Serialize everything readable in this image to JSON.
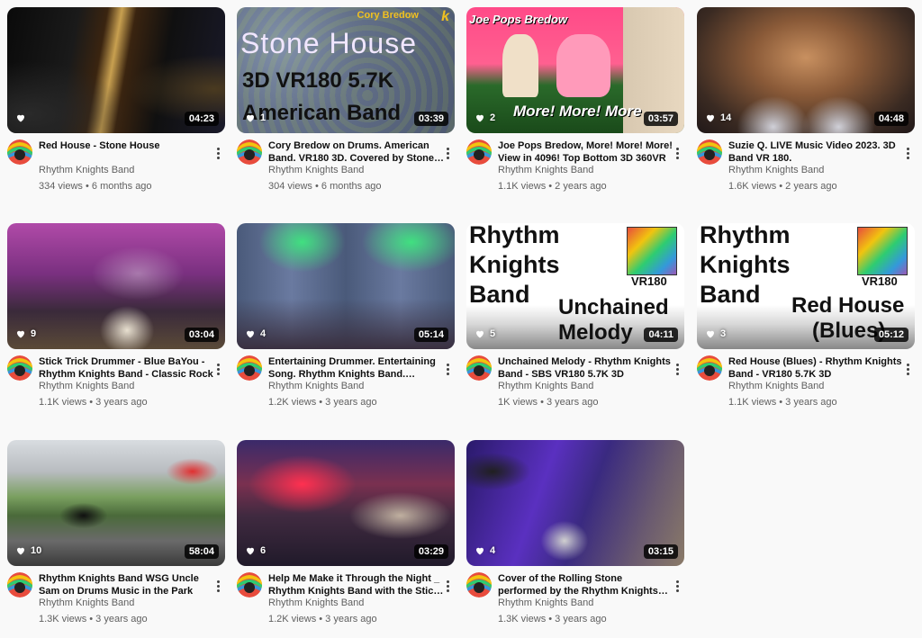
{
  "channel_name": "Rhythm Knights Band",
  "videos": [
    {
      "title": "Red House - Stone House",
      "views": "334 views",
      "age": "6 months ago",
      "likes": "",
      "duration": "04:23"
    },
    {
      "title": "Cory Bredow on Drums. American Band. VR180 3D. Covered by Stone House",
      "views": "304 views",
      "age": "6 months ago",
      "likes": "1",
      "duration": "03:39"
    },
    {
      "title": "Joe Pops Bredow, More! More! More! View in 4096! Top Bottom 3D 360VR",
      "views": "1.1K views",
      "age": "2 years ago",
      "likes": "2",
      "duration": "03:57"
    },
    {
      "title": "Suzie Q. LIVE Music Video 2023. 3D Band VR 180.",
      "views": "1.6K views",
      "age": "2 years ago",
      "likes": "14",
      "duration": "04:48"
    },
    {
      "title": "Stick Trick Drummer - Blue BaYou - Rhythm Knights Band - Classic Rock",
      "views": "1.1K views",
      "age": "3 years ago",
      "likes": "9",
      "duration": "03:04"
    },
    {
      "title": "Entertaining Drummer. Entertaining Song. Rhythm Knights Band. Stealing",
      "views": "1.2K views",
      "age": "3 years ago",
      "likes": "4",
      "duration": "05:14"
    },
    {
      "title": "Unchained Melody - Rhythm Knights Band - SBS VR180 5.7K 3D",
      "views": "1K views",
      "age": "3 years ago",
      "likes": "5",
      "duration": "04:11"
    },
    {
      "title": "Red House (Blues) - Rhythm Knights Band - VR180 5.7K 3D",
      "views": "1.1K views",
      "age": "3 years ago",
      "likes": "3",
      "duration": "05:12"
    },
    {
      "title": "Rhythm Knights Band WSG Uncle Sam on Drums Music in the Park",
      "views": "1.3K views",
      "age": "3 years ago",
      "likes": "10",
      "duration": "58:04"
    },
    {
      "title": "Help Me Make it Through the Night _ Rhythm Knights Band with the Stick Trick",
      "views": "1.2K views",
      "age": "3 years ago",
      "likes": "6",
      "duration": "03:29"
    },
    {
      "title": "Cover of the Rolling Stone performed by the Rhythm Knights Band",
      "views": "1.3K views",
      "age": "3 years ago",
      "likes": "4",
      "duration": "03:15"
    }
  ],
  "thumb_text": {
    "stone_house": {
      "brand": "Cory Bredow",
      "title": "Stone  House",
      "line2": "3D  VR180  5.7K",
      "line3": "American Band"
    },
    "joe_pops": {
      "title": "Joe Pops Bredow",
      "footer": "More!  More!  More"
    },
    "rkb_unchained": {
      "l1": "Rhythm",
      "l2": "Knights",
      "l3": "Band",
      "tag": "VR180",
      "s1": "Unchained",
      "s2": "Melody"
    },
    "rkb_redhouse": {
      "l1": "Rhythm",
      "l2": "Knights",
      "l3": "Band",
      "tag": "VR180",
      "s1": "Red House",
      "s2": "(Blues)"
    }
  },
  "colors": {
    "duration_bg": "#000000",
    "title": "#0f0f0f",
    "meta": "#606060",
    "page_bg": "#f9f9f9"
  }
}
